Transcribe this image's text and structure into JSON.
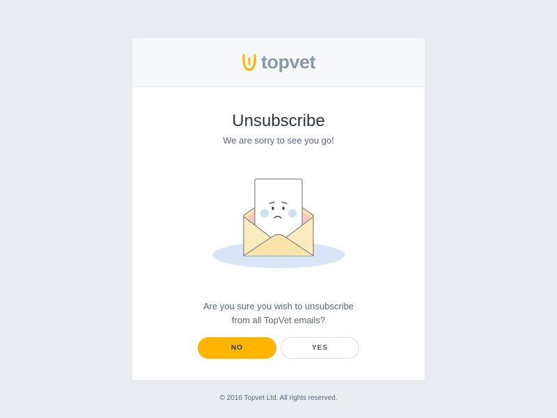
{
  "brand": {
    "name": "topvet",
    "logo_icon": "topvet-logo-icon",
    "accent_color": "#ffb400",
    "text_color": "#8a99ab"
  },
  "card": {
    "title": "Unsubscribe",
    "subtitle": "We are sorry to see you go!",
    "illustration_icon": "sad-envelope-icon",
    "question_line1": "Are you sure you wish to unsubscribe",
    "question_line2": "from all TopVet emails?"
  },
  "buttons": {
    "no_label": "NO",
    "yes_label": "YES"
  },
  "footer": {
    "copyright": "© 2016 Topvet Ltd. All rights reserved."
  }
}
